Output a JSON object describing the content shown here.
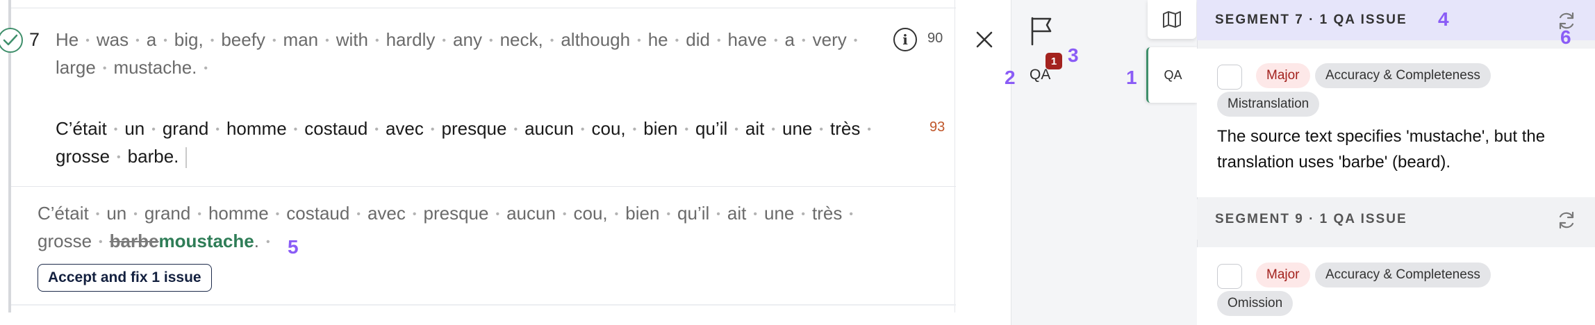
{
  "editor": {
    "segment_number": "7",
    "source": {
      "words": [
        "He",
        "was",
        "a",
        "big,",
        "beefy",
        "man",
        "with",
        "hardly",
        "any",
        "neck,",
        "although",
        "he",
        "did",
        "have",
        "a",
        "very",
        "large",
        "mustache."
      ],
      "score": "90"
    },
    "target": {
      "words": [
        "C’était",
        "un",
        "grand",
        "homme",
        "costaud",
        "avec",
        "presque",
        "aucun",
        "cou,",
        "bien",
        "qu’il",
        "ait",
        "une",
        "très",
        "grosse",
        "barbe."
      ],
      "score": "93"
    },
    "suggestion": {
      "words": [
        "C’était",
        "un",
        "grand",
        "homme",
        "costaud",
        "avec",
        "presque",
        "aucun",
        "cou,",
        "bien",
        "qu’il",
        "ait",
        "une",
        "très",
        "grosse"
      ],
      "deleted": "barbe",
      "inserted": "moustache",
      "trailing": ".",
      "accept_label": "Accept and fix 1 issue"
    }
  },
  "markers": [
    "1",
    "2",
    "3",
    "4",
    "5",
    "6"
  ],
  "rail": {
    "qa_label": "QA",
    "qa_badge": "1",
    "tab_qa_label": "QA",
    "icons": [
      "flag-icon",
      "map-icon"
    ]
  },
  "qa_panel": {
    "groups": [
      {
        "header": "SEGMENT 7 · 1 QA ISSUE",
        "severity": "Major",
        "category": "Accuracy & Completeness",
        "subcategory": "Mistranslation",
        "message": "The source text specifies 'mustache', but the translation uses 'barbe' (beard)."
      },
      {
        "header": "SEGMENT 9 · 1 QA ISSUE",
        "severity": "Major",
        "category": "Accuracy & Completeness",
        "subcategory": "Omission"
      }
    ]
  },
  "colors": {
    "accent_purple": "#8a5cf6",
    "insert_green": "#2f7d57",
    "badge_red": "#a3221e",
    "active_header": "#e6e5fa"
  }
}
